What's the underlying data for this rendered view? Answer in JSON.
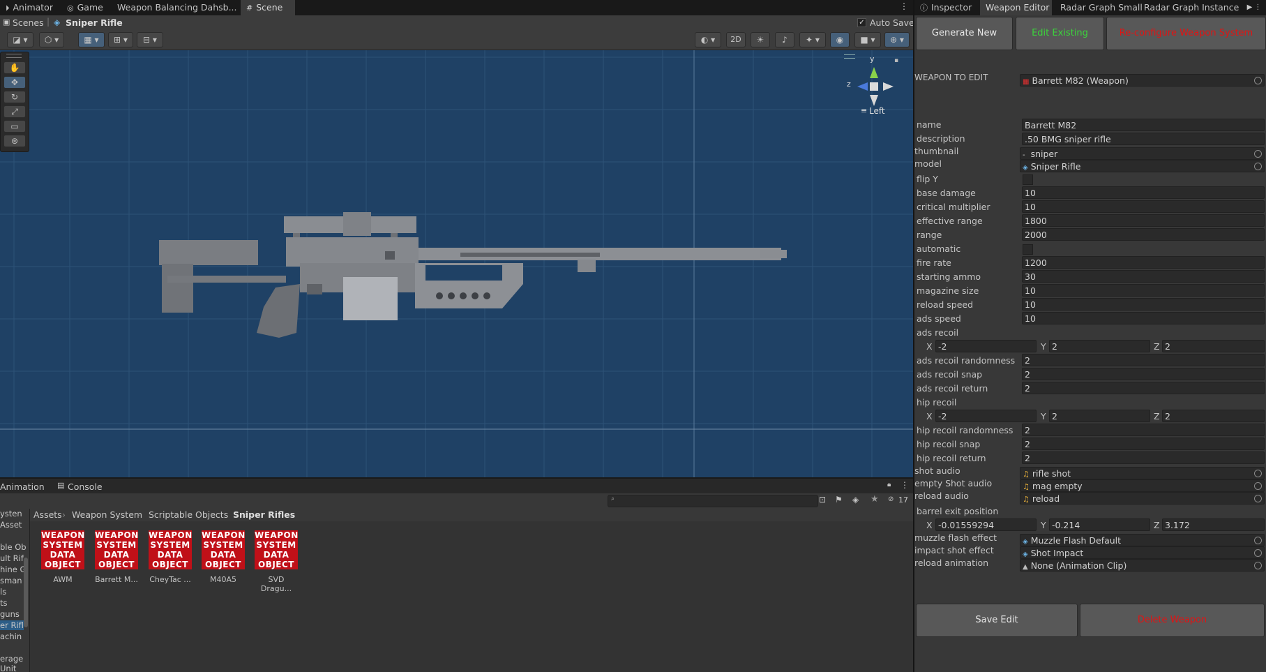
{
  "tabs_left": [
    "Animator",
    "Game",
    "Weapon Balancing Dahsb...",
    "Scene"
  ],
  "tabs_right": [
    "Inspector",
    "Weapon Editor",
    "Radar Graph Small",
    "Radar Graph Instance"
  ],
  "scene_bar": {
    "scenes": "Scenes",
    "current": "Sniper Rifle",
    "auto_save": "Auto Save"
  },
  "scene_toolbar": {
    "mode_2d": "2D"
  },
  "gizmo": {
    "y": "y",
    "z": "z",
    "view": "Left"
  },
  "editor": {
    "generate_new": "Generate New",
    "edit_existing": "Edit Existing",
    "reconfigure": "Re-configure Weapon System",
    "weapon_to_edit_label": "WEAPON TO EDIT",
    "weapon_to_edit_value": "Barrett M82 (Weapon)",
    "fields": {
      "name": {
        "label": "name",
        "value": "Barrett M82"
      },
      "description": {
        "label": "description",
        "value": ".50 BMG sniper rifle"
      },
      "thumbnail": {
        "label": "thumbnail",
        "value": "sniper"
      },
      "model": {
        "label": "model",
        "value": "Sniper Rifle"
      },
      "flip_y": {
        "label": "flip Y"
      },
      "base_damage": {
        "label": "base damage",
        "value": "10"
      },
      "critical_multiplier": {
        "label": "critical multiplier",
        "value": "10"
      },
      "effective_range": {
        "label": "effective range",
        "value": "1800"
      },
      "range": {
        "label": "range",
        "value": "2000"
      },
      "automatic": {
        "label": "automatic"
      },
      "fire_rate": {
        "label": "fire rate",
        "value": "1200"
      },
      "starting_ammo": {
        "label": "starting ammo",
        "value": "30"
      },
      "magazine_size": {
        "label": "magazine size",
        "value": "10"
      },
      "reload_speed": {
        "label": "reload speed",
        "value": "10"
      },
      "ads_speed": {
        "label": "ads speed",
        "value": "10"
      },
      "ads_recoil": {
        "label": "ads recoil",
        "x": "-2",
        "y": "2",
        "z": "2"
      },
      "ads_recoil_randomness": {
        "label": "ads recoil randomness",
        "value": "2"
      },
      "ads_recoil_snap": {
        "label": "ads recoil snap",
        "value": "2"
      },
      "ads_recoil_return": {
        "label": "ads recoil return",
        "value": "2"
      },
      "hip_recoil": {
        "label": "hip recoil",
        "x": "-2",
        "y": "2",
        "z": "2"
      },
      "hip_recoil_randomness": {
        "label": "hip recoil randomness",
        "value": "2"
      },
      "hip_recoil_snap": {
        "label": "hip recoil snap",
        "value": "2"
      },
      "hip_recoil_return": {
        "label": "hip recoil return",
        "value": "2"
      },
      "shot_audio": {
        "label": "shot audio",
        "value": "rifle shot"
      },
      "empty_shot_audio": {
        "label": "empty Shot audio",
        "value": "mag empty"
      },
      "reload_audio": {
        "label": "reload audio",
        "value": "reload"
      },
      "barrel_exit_position": {
        "label": "barrel exit position",
        "x": "-0.01559294",
        "y": "-0.214",
        "z": "3.172"
      },
      "muzzle_flash_effect": {
        "label": "muzzle flash effect",
        "value": "Muzzle Flash Default"
      },
      "impact_shot_effect": {
        "label": "impact shot effect",
        "value": "Shot Impact"
      },
      "reload_animation": {
        "label": "reload animation",
        "value": "None (Animation Clip)"
      }
    },
    "axis": {
      "x": "X",
      "y": "Y",
      "z": "Z"
    },
    "save_edit": "Save Edit",
    "delete_weapon": "Delete Weapon"
  },
  "bottom": {
    "tabs": [
      "Animation",
      "Console"
    ],
    "hidden_count": "17",
    "breadcrumb": [
      "Assets",
      "Weapon System",
      "Scriptable Objects",
      "Sniper Rifles"
    ],
    "tree": [
      "ysten",
      "Asset",
      "",
      "ble Ob",
      "ult Rif",
      "hine G",
      "sman",
      "ls",
      "ts",
      "guns",
      "er Rifl",
      "achin",
      "",
      "erage",
      "Unit"
    ],
    "icon_text": [
      "WEAPON",
      "SYSTEM",
      "DATA",
      "OBJECT"
    ],
    "assets": [
      "AWM",
      "Barrett M...",
      "CheyTac ...",
      "M40A5",
      "SVD Dragu..."
    ]
  },
  "colors": {
    "scene_bg": "#1f4165",
    "panel": "#383838",
    "edit_existing": "#3bd43b",
    "danger": "#e01414",
    "icon_red": "#c01018"
  }
}
